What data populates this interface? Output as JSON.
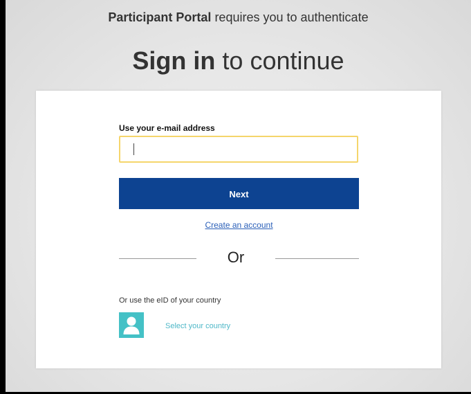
{
  "header": {
    "portal_name": "Participant Portal",
    "auth_message": " requires you to authenticate",
    "signin_bold": "Sign in",
    "signin_rest": " to continue"
  },
  "form": {
    "email_label": "Use your e-mail address",
    "email_value": "",
    "next_label": "Next",
    "create_account": "Create an account",
    "or_text": "Or",
    "eid_label": "Or use the eID of your country",
    "select_country": "Select your country"
  },
  "colors": {
    "primary_button": "#0d4391",
    "input_focus_border": "#f5d56b",
    "link": "#2a5fb8",
    "eid_accent": "#44c1c6"
  },
  "icons": {
    "eid": "user-icon"
  }
}
